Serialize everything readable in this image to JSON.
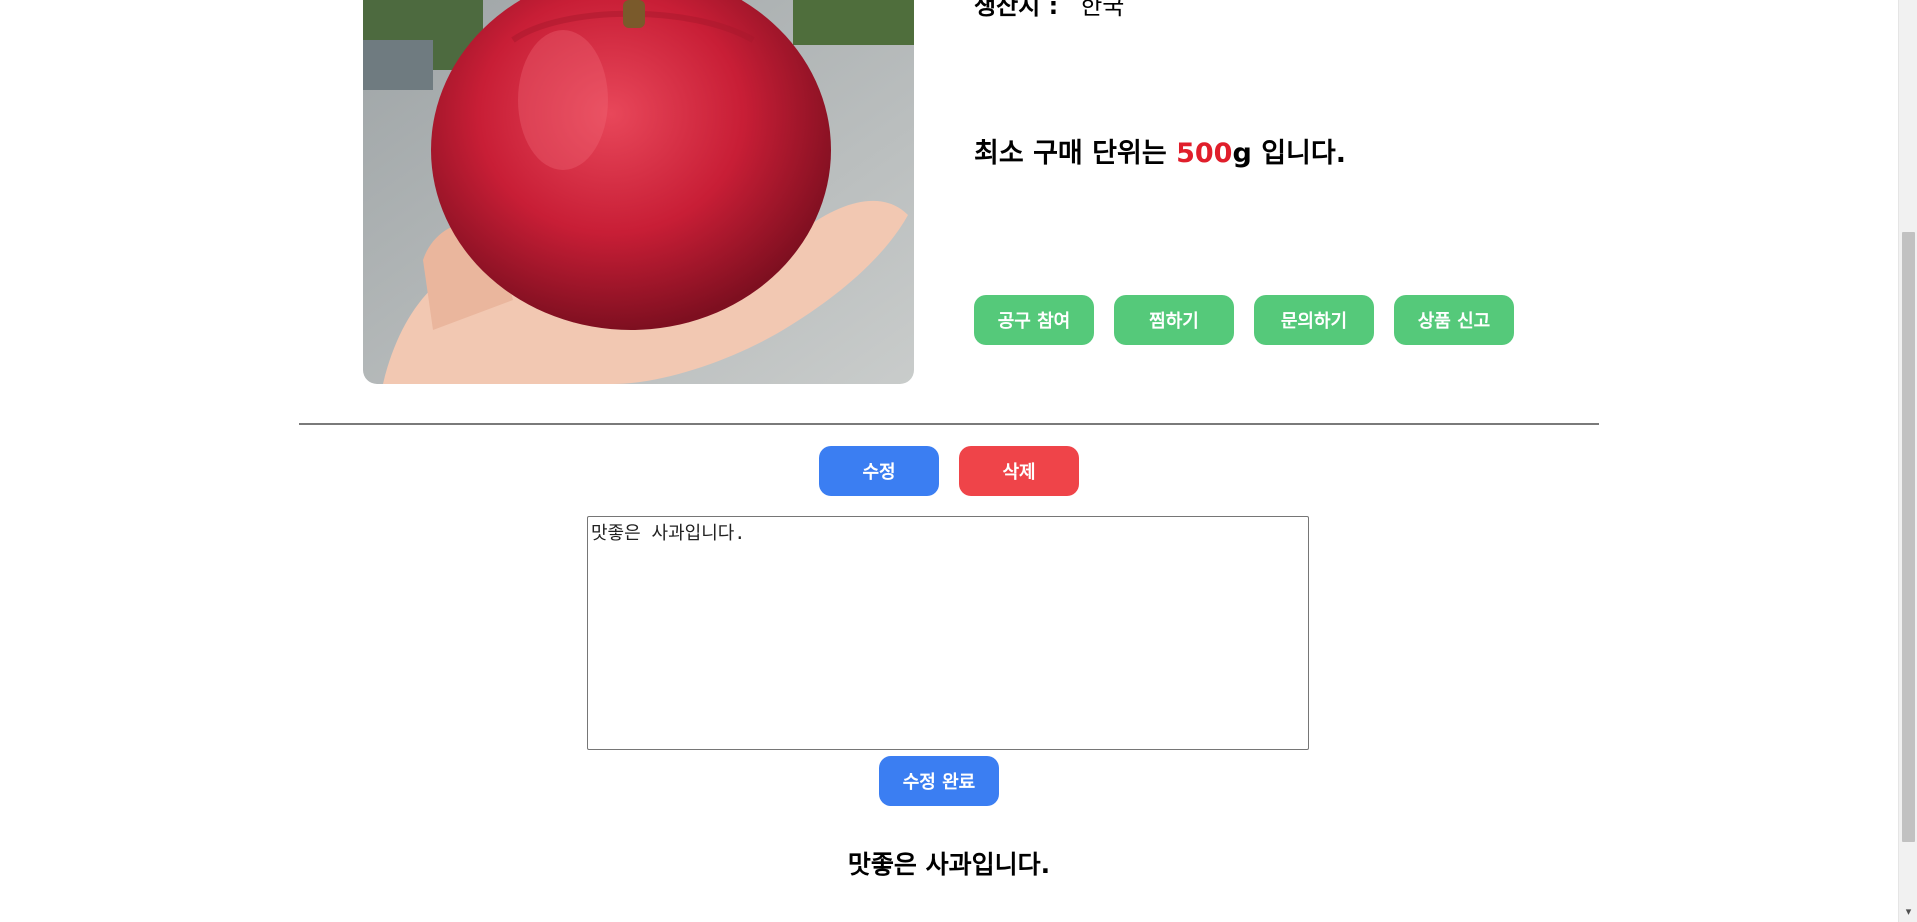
{
  "product": {
    "image_alt": "red apple in hand",
    "origin_label": "생산지 :",
    "origin_value": "한국",
    "min_unit_prefix": "최소 구매 단위는 ",
    "min_unit_amount": "500",
    "min_unit_suffix": "g 입니다."
  },
  "actions": {
    "group_buy": "공구 참여",
    "wishlist": "찜하기",
    "inquiry": "문의하기",
    "report": "상품 신고"
  },
  "admin": {
    "edit": "수정",
    "delete": "삭제"
  },
  "editor": {
    "value": "맛좋은 사과입니다.",
    "submit": "수정 완료"
  },
  "description": "맛좋은 사과입니다.",
  "colors": {
    "green": "#55c97a",
    "blue": "#3b7ef2",
    "red": "#ef4449",
    "highlight": "#e01e2b"
  }
}
